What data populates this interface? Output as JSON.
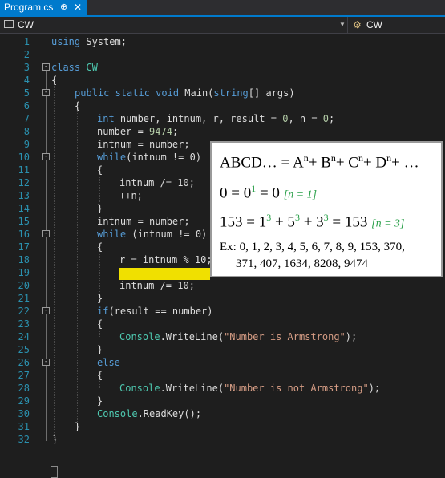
{
  "tab": {
    "label": "Program.cs",
    "pin": "⊕",
    "close": "✕"
  },
  "nav": {
    "left_value": "CW",
    "right_value": "CW",
    "class_icon_text": "C#"
  },
  "code": {
    "line_numbers": [
      "1",
      "2",
      "3",
      "4",
      "5",
      "6",
      "7",
      "8",
      "9",
      "10",
      "11",
      "12",
      "13",
      "14",
      "15",
      "16",
      "17",
      "18",
      "19",
      "20",
      "21",
      "22",
      "23",
      "24",
      "25",
      "26",
      "27",
      "28",
      "29",
      "30",
      "31",
      "32"
    ],
    "l1_kw": "using",
    "l1_rest": " System;",
    "l3_kw": "class",
    "l3_cls": " CW",
    "l4": "{",
    "l5_kw1": "public",
    "l5_kw2": " static",
    "l5_kw3": " void",
    "l5_m": " Main(",
    "l5_kw4": "string",
    "l5_rest": "[] args)",
    "l6": "{",
    "l7_kw": "int",
    "l7_a": " number, intnum, r, result = ",
    "l7_n1": "0",
    "l7_b": ", n = ",
    "l7_n2": "0",
    "l7_c": ";",
    "l8_a": "number = ",
    "l8_n": "9474",
    "l8_b": ";",
    "l9": "intnum = number;",
    "l10_kw": "while",
    "l10_rest": "(intnum != 0)",
    "l11": "{",
    "l12": "intnum /= 10;",
    "l13": "++n;",
    "l14": "}",
    "l15": "intnum = number;",
    "l16_kw": "while",
    "l16_rest": " (intnum != 0)",
    "l17": "{",
    "l18": "r = intnum % 10;",
    "l20": "intnum /= 10;",
    "l21": "}",
    "l22_kw": "if",
    "l22_rest": "(result == number)",
    "l23": "{",
    "l24_cls": "Console",
    "l24_a": ".WriteLine(",
    "l24_str": "\"Number is Armstrong\"",
    "l24_b": ");",
    "l25": "}",
    "l26_kw": "else",
    "l27": "{",
    "l28_cls": "Console",
    "l28_a": ".WriteLine(",
    "l28_str": "\"Number is not Armstrong\"",
    "l28_b": ");",
    "l29": "}",
    "l30_cls": "Console",
    "l30_a": ".ReadKey();",
    "l31": "}",
    "l32": "}"
  },
  "overlay": {
    "formula1": "ABCD… = A",
    "formula1_b": "+ B",
    "formula1_c": "+ C",
    "formula1_d": "+ D",
    "formula1_e": "+ …",
    "exp_n": "n",
    "ex1_a": "0 = 0",
    "ex1_exp": "1",
    "ex1_b": " = 0",
    "ex1_note": "[n = 1]",
    "ex2_a": "153 = 1",
    "ex2_exp": "3",
    "ex2_b": " + 5",
    "ex2_c": " + 3",
    "ex2_d": " = 153",
    "ex2_note": "[n = 3]",
    "examples_line1": "Ex: 0, 1, 2, 3, 4, 5, 6, 7, 8, 9, 153, 370,",
    "examples_line2": "371, 407, 1634, 8208, 9474"
  },
  "colors": {
    "accent": "#007acc",
    "highlight": "#f0e000",
    "note_green": "#2aa04a"
  }
}
